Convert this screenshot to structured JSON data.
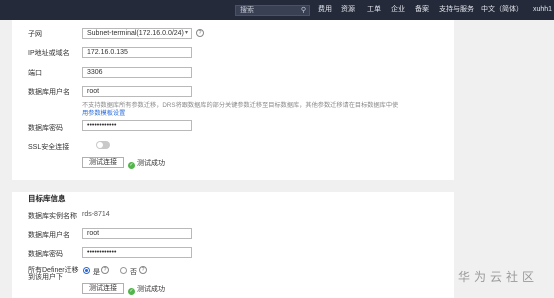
{
  "topbar": {
    "search_placeholder": "搜索",
    "nav": [
      "费用",
      "资源",
      "工单",
      "企业",
      "备案",
      "支持与服务",
      "中文（简体）",
      "xuhh1"
    ]
  },
  "source": {
    "subnet_label": "子网",
    "subnet_value": "Subnet-terminal(172.16.0.0/24)",
    "ip_label": "IP地址或域名",
    "ip_value": "172.16.0.135",
    "port_label": "端口",
    "port_value": "3306",
    "user_label": "数据库用户名",
    "user_value": "root",
    "user_note_line1": "不支持数据库所有参数迁移，DRS将跟数据库的部分关键参数迁移至目标数据库，其他参数迁移请在目标数据库中使",
    "user_note_link": "用参数模板设置",
    "password_label": "数据库密码",
    "password_value": "••••••••••••",
    "ssl_label": "SSL安全连接",
    "test_button": "测试连接",
    "test_result": "测试成功"
  },
  "target": {
    "title": "目标库信息",
    "instance_label": "数据库实例名称",
    "instance_value": "rds-8714",
    "user_label": "数据库用户名",
    "user_value": "root",
    "password_label": "数据库密码",
    "password_value": "••••••••••••",
    "definer_label_line1": "所有Definer迁移",
    "definer_label_line2": "到该用户下",
    "definer_options": [
      "是",
      "否"
    ],
    "test_button": "测试连接",
    "test_result": "测试成功"
  },
  "watermark": "华为云社区"
}
